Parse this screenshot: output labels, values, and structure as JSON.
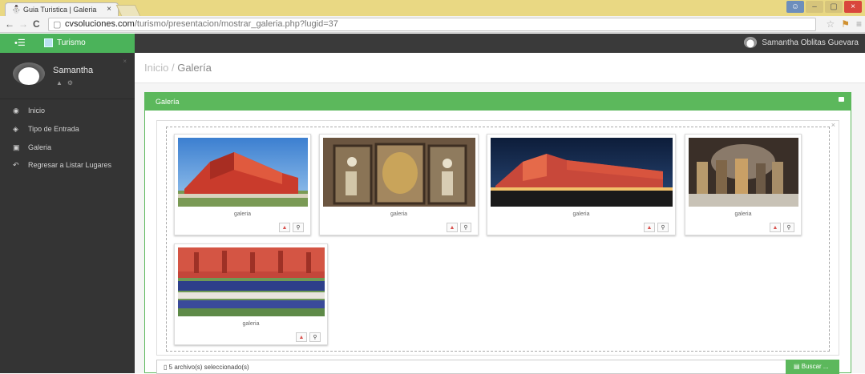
{
  "browser": {
    "tab_title": "Guia Turistica | Galeria",
    "tab_close": "×",
    "url_host": "cvsoluciones.com",
    "url_path": "/turismo/presentacion/mostrar_galeria.php?lugid=37",
    "window_buttons": [
      "–",
      "▢",
      "×"
    ]
  },
  "topnav": {
    "menu_glyph": "•☰",
    "brand": "Turismo",
    "user_name": "Samantha Oblitas Guevara"
  },
  "sidebar": {
    "profile_name": "Samantha",
    "items": [
      {
        "icon": "dashboard-icon",
        "label": "Inicio"
      },
      {
        "icon": "tag-icon",
        "label": "Tipo de Entrada"
      },
      {
        "icon": "image-icon",
        "label": "Galeria"
      },
      {
        "icon": "reply-icon",
        "label": "Regresar a Listar Lugares"
      }
    ]
  },
  "breadcrumb": {
    "home": "Inicio",
    "separator": " / ",
    "current": "Galería"
  },
  "panel": {
    "title": "Galería"
  },
  "gallery": {
    "close": "×",
    "images": [
      {
        "caption": "galeria"
      },
      {
        "caption": "galeria"
      },
      {
        "caption": "galeria"
      },
      {
        "caption": "galeria"
      },
      {
        "caption": "galeria"
      }
    ]
  },
  "upload": {
    "status": "5 archivo(s) seleccionado(s)",
    "search_button": "Buscar ..."
  },
  "colors": {
    "brand_green": "#5cb85c",
    "sidebar_bg": "#343434",
    "topbar_bg": "#3a3a3a",
    "danger": "#d9534f"
  }
}
